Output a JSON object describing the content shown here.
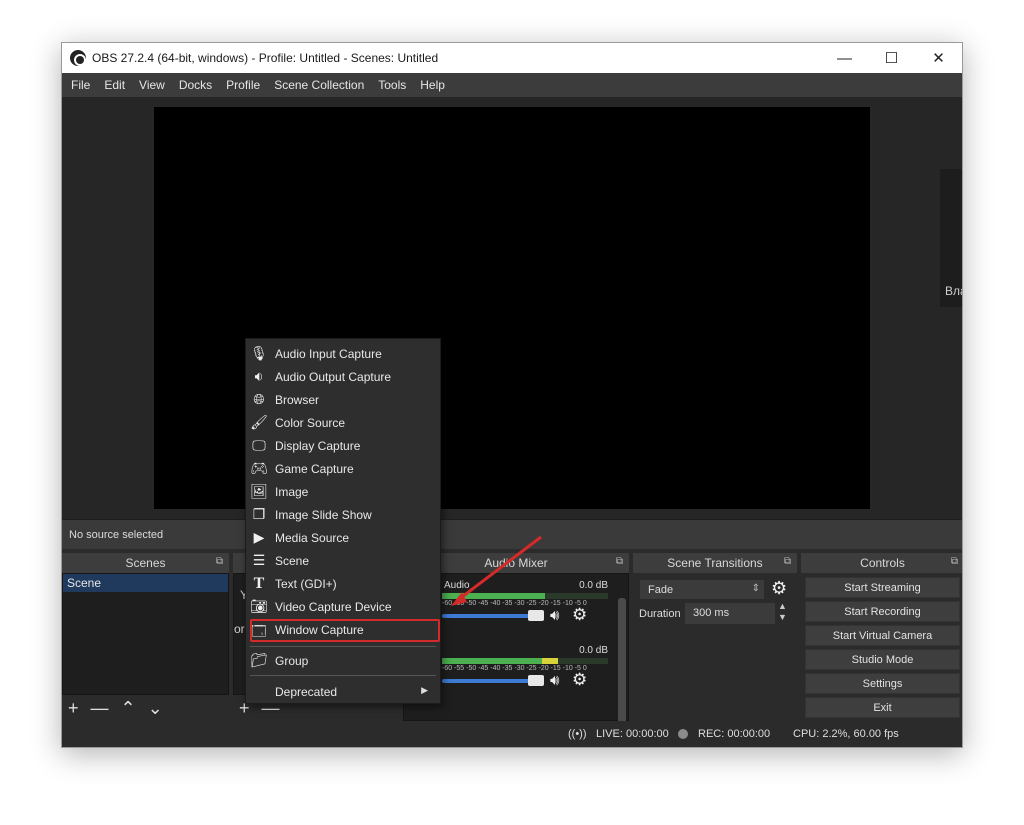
{
  "window": {
    "title": "OBS 27.2.4 (64-bit, windows) - Profile: Untitled - Scenes: Untitled",
    "controls": {
      "minimize": "—",
      "maximize": "☐",
      "close": "✕"
    }
  },
  "menubar": [
    "File",
    "Edit",
    "View",
    "Docks",
    "Profile",
    "Scene Collection",
    "Tools",
    "Help"
  ],
  "side_dock_label": "Вла",
  "source_status": "No source selected",
  "scenes": {
    "title": "Scenes",
    "items": [
      "Scene"
    ],
    "footer": {
      "add": "+",
      "remove": "—",
      "up": "⌃",
      "down": "⌄"
    }
  },
  "sources": {
    "peek_y": "Y",
    "peek_or": "or",
    "footer": {
      "add": "+",
      "remove": "—"
    }
  },
  "audio_mixer": {
    "title": "Audio Mixer",
    "channels": [
      {
        "name": "Audio",
        "db": "0.0 dB",
        "ticks": "-60 -55 -50 -45 -40 -35 -30 -25 -20 -15 -10 -5 0",
        "level": 0.62
      },
      {
        "name": "",
        "db": "0.0 dB",
        "ticks": "-60 -55 -50 -45 -40 -35 -30 -25 -20 -15 -10 -5 0",
        "level": 0.7
      }
    ]
  },
  "scene_transitions": {
    "title": "Scene Transitions",
    "transition": "Fade",
    "duration_label": "Duration",
    "duration_value": "300 ms"
  },
  "controls": {
    "title": "Controls",
    "buttons": [
      "Start Streaming",
      "Start Recording",
      "Start Virtual Camera",
      "Studio Mode",
      "Settings",
      "Exit"
    ]
  },
  "statusbar": {
    "live": "LIVE: 00:00:00",
    "rec": "REC: 00:00:00",
    "cpu": "CPU: 2.2%, 60.00 fps"
  },
  "context_menu": {
    "items": [
      {
        "label": "Audio Input Capture",
        "icon": "microphone-icon"
      },
      {
        "label": "Audio Output Capture",
        "icon": "speaker-icon"
      },
      {
        "label": "Browser",
        "icon": "globe-icon"
      },
      {
        "label": "Color Source",
        "icon": "brush-icon"
      },
      {
        "label": "Display Capture",
        "icon": "monitor-icon"
      },
      {
        "label": "Game Capture",
        "icon": "gamepad-icon"
      },
      {
        "label": "Image",
        "icon": "image-icon"
      },
      {
        "label": "Image Slide Show",
        "icon": "slideshow-icon"
      },
      {
        "label": "Media Source",
        "icon": "play-icon"
      },
      {
        "label": "Scene",
        "icon": "list-icon"
      },
      {
        "label": "Text (GDI+)",
        "icon": "text-icon"
      },
      {
        "label": "Video Capture Device",
        "icon": "camera-icon"
      },
      {
        "label": "Window Capture",
        "icon": "window-icon"
      }
    ],
    "group": {
      "label": "Group",
      "icon": "folder-icon"
    },
    "deprecated": {
      "label": "Deprecated",
      "icon": ""
    }
  },
  "colors": {
    "highlight": "#d42a2a",
    "accent": "#3d7bd4"
  }
}
